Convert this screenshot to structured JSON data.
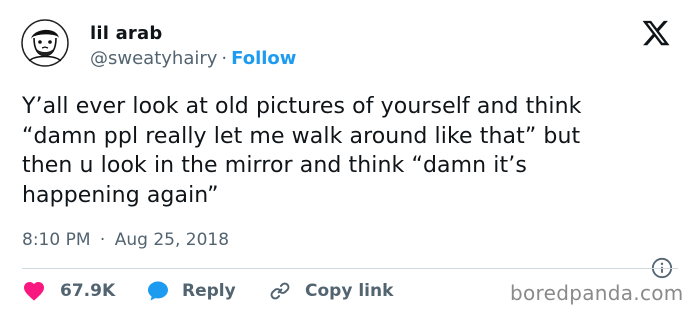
{
  "author": {
    "display_name": "lil arab",
    "handle": "@sweatyhairy",
    "separator": "·",
    "follow_label": "Follow"
  },
  "tweet": {
    "text": "Y’all ever look at old pictures of yourself and think\n“damn ppl really let me walk around like that” but\nthen u look in the mirror and think “damn it’s\nhappening again”",
    "time": "8:10 PM",
    "separator": "·",
    "date": "Aug 25, 2018"
  },
  "actions": {
    "like_count": "67.9K",
    "reply_label": "Reply",
    "copy_label": "Copy link"
  },
  "watermark": "boredpanda.com",
  "icons": {
    "brand": "x-logo-icon",
    "info": "info-icon",
    "like": "heart-icon",
    "reply": "reply-bubble-icon",
    "copy": "link-icon"
  },
  "colors": {
    "text": "#0f1419",
    "secondary": "#536471",
    "accent": "#1d9bf0",
    "like": "#f91880",
    "divider": "#cfd9de"
  }
}
